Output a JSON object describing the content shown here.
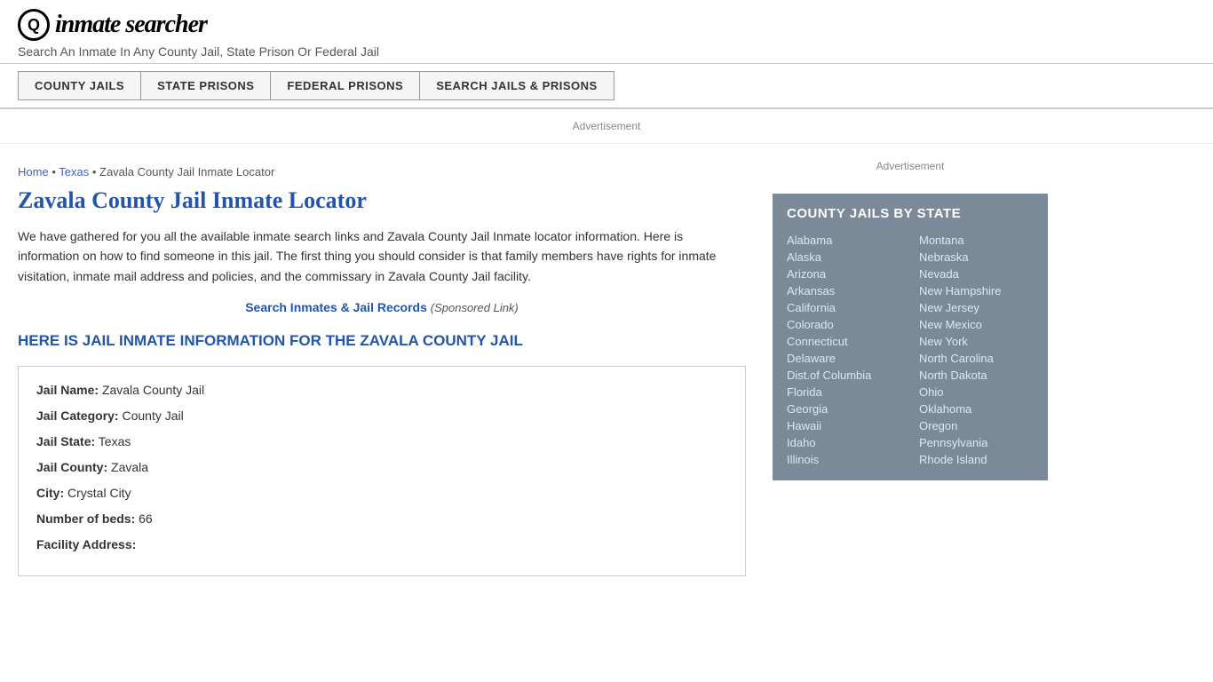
{
  "header": {
    "logo_icon": "🔍",
    "logo_text_1": "inmate",
    "logo_text_2": "searcher",
    "tagline": "Search An Inmate In Any County Jail, State Prison Or Federal Jail"
  },
  "nav": {
    "items": [
      {
        "label": "COUNTY JAILS",
        "id": "county-jails"
      },
      {
        "label": "STATE PRISONS",
        "id": "state-prisons"
      },
      {
        "label": "FEDERAL PRISONS",
        "id": "federal-prisons"
      },
      {
        "label": "SEARCH JAILS & PRISONS",
        "id": "search-jails"
      }
    ]
  },
  "ad": {
    "label": "Advertisement"
  },
  "breadcrumb": {
    "home": "Home",
    "state": "Texas",
    "current": "Zavala County Jail Inmate Locator"
  },
  "page": {
    "title": "Zavala County Jail Inmate Locator",
    "description": "We have gathered for you all the available inmate search links and Zavala County Jail Inmate locator information. Here is information on how to find someone in this jail. The first thing you should consider is that family members have rights for inmate visitation, inmate mail address and policies, and the commissary in Zavala County Jail facility.",
    "search_link_text": "Search Inmates & Jail Records",
    "search_link_sponsored": "(Sponsored Link)",
    "section_heading": "HERE IS JAIL INMATE INFORMATION FOR THE ZAVALA COUNTY JAIL"
  },
  "jail_info": {
    "fields": [
      {
        "label": "Jail Name:",
        "value": "Zavala County Jail"
      },
      {
        "label": "Jail Category:",
        "value": "County Jail"
      },
      {
        "label": "Jail State:",
        "value": "Texas"
      },
      {
        "label": "Jail County:",
        "value": "Zavala"
      },
      {
        "label": "City:",
        "value": "Crystal City"
      },
      {
        "label": "Number of beds:",
        "value": "66"
      },
      {
        "label": "Facility Address:",
        "value": ""
      }
    ]
  },
  "sidebar": {
    "ad_label": "Advertisement",
    "county_jails_title": "COUNTY JAILS BY STATE",
    "states_col1": [
      "Alabama",
      "Alaska",
      "Arizona",
      "Arkansas",
      "California",
      "Colorado",
      "Connecticut",
      "Delaware",
      "Dist.of Columbia",
      "Florida",
      "Georgia",
      "Hawaii",
      "Idaho",
      "Illinois"
    ],
    "states_col2": [
      "Montana",
      "Nebraska",
      "Nevada",
      "New Hampshire",
      "New Jersey",
      "New Mexico",
      "New York",
      "North Carolina",
      "North Dakota",
      "Ohio",
      "Oklahoma",
      "Oregon",
      "Pennsylvania",
      "Rhode Island"
    ]
  }
}
